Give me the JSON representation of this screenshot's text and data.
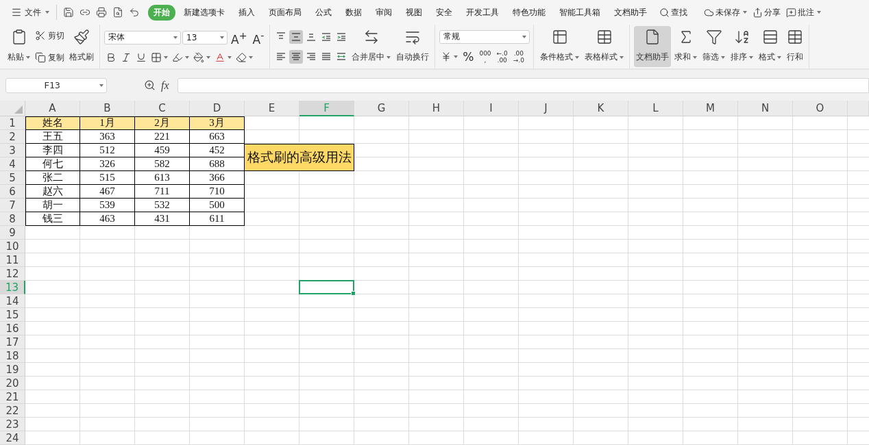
{
  "menu": {
    "file": "文件",
    "tabs": [
      {
        "label": "开始",
        "selected": true
      },
      {
        "label": "新建选项卡",
        "selected": false
      },
      {
        "label": "插入",
        "selected": false
      },
      {
        "label": "页面布局",
        "selected": false
      },
      {
        "label": "公式",
        "selected": false
      },
      {
        "label": "数据",
        "selected": false
      },
      {
        "label": "审阅",
        "selected": false
      },
      {
        "label": "视图",
        "selected": false
      },
      {
        "label": "安全",
        "selected": false
      },
      {
        "label": "开发工具",
        "selected": false
      },
      {
        "label": "特色功能",
        "selected": false
      },
      {
        "label": "智能工具箱",
        "selected": false
      },
      {
        "label": "文档助手",
        "selected": false
      }
    ],
    "search": "查找",
    "save_status": "未保存",
    "share": "分享",
    "comment": "批注"
  },
  "ribbon": [
    {
      "columns": [
        {
          "kind": "large",
          "label": "粘贴",
          "dropdown": true
        },
        {
          "kind": "stack",
          "items": [
            {
              "label": "剪切"
            },
            {
              "label": "复制"
            }
          ]
        },
        {
          "kind": "large",
          "label": "格式刷"
        }
      ]
    },
    {
      "columns": [
        {
          "kind": "rows",
          "rows": [
            [
              {
                "kind": "select",
                "value": "宋体"
              },
              {
                "kind": "select",
                "value": "13"
              },
              {
                "kind": "glyph",
                "text": "A$^{+}$"
              },
              {
                "kind": "glyph",
                "text": "A$^{-}$"
              }
            ],
            [
              {
                "kind": "icon"
              },
              {
                "kind": "icon"
              },
              {
                "kind": "icon"
              },
              {
                "kind": "icon",
                "dropdown": true
              },
              {
                "kind": "icon",
                "dropdown": true
              },
              {
                "kind": "icon",
                "dropdown": true
              },
              {
                "kind": "icon",
                "dropdown": true
              },
              {
                "kind": "icon",
                "dropdown": true
              }
            ]
          ]
        }
      ]
    },
    {
      "columns": [
        {
          "kind": "rows",
          "rows": [
            [
              {
                "kind": "icon",
                "selected": false
              },
              {
                "kind": "icon",
                "selected": true
              },
              {
                "kind": "icon",
                "selected": false
              },
              {
                "kind": "icon",
                "selected": false
              },
              {
                "kind": "icon",
                "selected": false
              }
            ],
            [
              {
                "kind": "icon",
                "selected": false
              },
              {
                "kind": "icon",
                "selected": true
              },
              {
                "kind": "icon",
                "selected": false
              },
              {
                "kind": "icon",
                "selected": false
              },
              {
                "kind": "icon",
                "selected": false
              }
            ]
          ]
        },
        {
          "kind": "large",
          "label": "合并居中",
          "dropdown": true
        },
        {
          "kind": "large",
          "label": "自动换行"
        }
      ]
    },
    {
      "columns": [
        {
          "kind": "rows",
          "rows": [
            [
              {
                "kind": "select",
                "value": "常规"
              }
            ],
            [
              {
                "kind": "icon",
                "dropdown": true
              },
              {
                "kind": "glyph",
                "text": "%"
              },
              {
                "kind": "glyph",
                "text": "000\n,"
              },
              {
                "kind": "glyph",
                "text": "←.0\n.00"
              },
              {
                "kind": "glyph",
                "text": ".00\n→.0"
              }
            ]
          ]
        }
      ]
    },
    {
      "columns": [
        {
          "kind": "large",
          "label": "条件格式",
          "dropdown": true
        },
        {
          "kind": "large",
          "label": "表格样式",
          "dropdown": true
        }
      ]
    },
    {
      "columns": [
        {
          "kind": "large",
          "label": "文档助手",
          "selected": true
        },
        {
          "kind": "large",
          "label": "求和",
          "dropdown": true
        },
        {
          "kind": "large",
          "label": "筛选",
          "dropdown": true
        },
        {
          "kind": "large",
          "label": "排序",
          "dropdown": true
        },
        {
          "kind": "large",
          "label": "格式",
          "dropdown": true
        },
        {
          "kind": "large",
          "label": "行和"
        }
      ]
    }
  ],
  "formula_bar": {
    "name_box": "F13",
    "fx": "fx"
  },
  "columns": [
    {
      "label": "A",
      "selected": false
    },
    {
      "label": "B",
      "selected": false
    },
    {
      "label": "C",
      "selected": false
    },
    {
      "label": "D",
      "selected": false
    },
    {
      "label": "E",
      "selected": false
    },
    {
      "label": "F",
      "selected": true
    },
    {
      "label": "G",
      "selected": false
    },
    {
      "label": "H",
      "selected": false
    },
    {
      "label": "I",
      "selected": false
    },
    {
      "label": "J",
      "selected": false
    },
    {
      "label": "K",
      "selected": false
    },
    {
      "label": "L",
      "selected": false
    },
    {
      "label": "M",
      "selected": false
    },
    {
      "label": "N",
      "selected": false
    },
    {
      "label": "O",
      "selected": false
    }
  ],
  "rows": [
    {
      "header": "1",
      "selected": false,
      "kind": "header",
      "cells": [
        "姓名",
        "1月",
        "2月",
        "3月"
      ]
    },
    {
      "header": "2",
      "selected": false,
      "kind": "data",
      "cells": [
        "王五",
        "363",
        "221",
        "663"
      ]
    },
    {
      "header": "3",
      "selected": false,
      "kind": "data",
      "cells": [
        "李四",
        "512",
        "459",
        "452"
      ],
      "merged": {
        "text": "格式刷的高级用法"
      }
    },
    {
      "header": "4",
      "selected": false,
      "kind": "data",
      "cells": [
        "何七",
        "326",
        "582",
        "688"
      ]
    },
    {
      "header": "5",
      "selected": false,
      "kind": "data",
      "cells": [
        "张二",
        "515",
        "613",
        "366"
      ]
    },
    {
      "header": "6",
      "selected": false,
      "kind": "data",
      "cells": [
        "赵六",
        "467",
        "711",
        "710"
      ]
    },
    {
      "header": "7",
      "selected": false,
      "kind": "data",
      "cells": [
        "胡一",
        "539",
        "532",
        "500"
      ]
    },
    {
      "header": "8",
      "selected": false,
      "kind": "data",
      "cells": [
        "钱三",
        "463",
        "431",
        "611"
      ]
    },
    {
      "header": "9",
      "selected": false,
      "kind": "empty"
    },
    {
      "header": "10",
      "selected": false,
      "kind": "empty"
    },
    {
      "header": "11",
      "selected": false,
      "kind": "empty"
    },
    {
      "header": "12",
      "selected": false,
      "kind": "empty"
    },
    {
      "header": "13",
      "selected": true,
      "kind": "empty"
    },
    {
      "header": "14",
      "selected": false,
      "kind": "empty"
    },
    {
      "header": "15",
      "selected": false,
      "kind": "empty"
    },
    {
      "header": "16",
      "selected": false,
      "kind": "empty"
    },
    {
      "header": "17",
      "selected": false,
      "kind": "empty"
    },
    {
      "header": "18",
      "selected": false,
      "kind": "empty"
    },
    {
      "header": "19",
      "selected": false,
      "kind": "empty"
    },
    {
      "header": "20",
      "selected": false,
      "kind": "empty"
    },
    {
      "header": "21",
      "selected": false,
      "kind": "empty"
    },
    {
      "header": "22",
      "selected": false,
      "kind": "empty"
    },
    {
      "header": "23",
      "selected": false,
      "kind": "empty"
    },
    {
      "header": "24",
      "selected": false,
      "kind": "empty"
    }
  ]
}
